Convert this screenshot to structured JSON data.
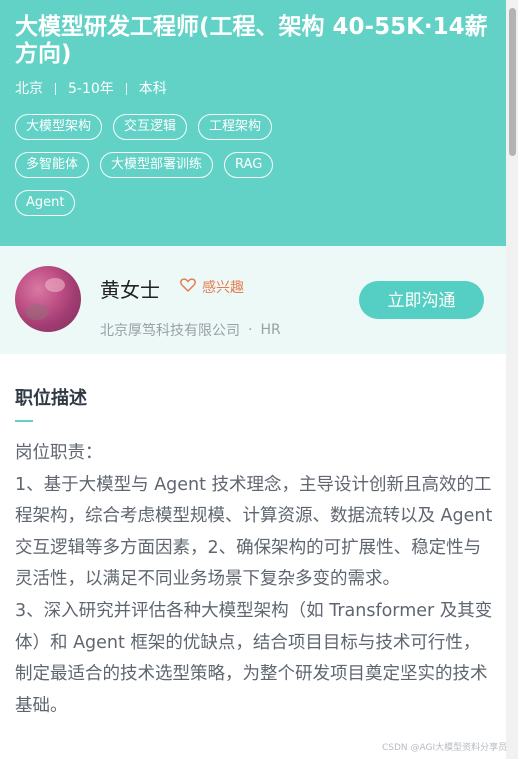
{
  "job": {
    "title": "大模型研发工程师(工程、架构 40-55K·14薪方向)",
    "city": "北京",
    "experience": "5-10年",
    "education": "本科",
    "tags_row1": [
      "大模型架构",
      "交互逻辑",
      "工程架构"
    ],
    "tags_row2": [
      "多智能体",
      "大模型部署训练",
      "RAG"
    ],
    "tags_row3": [
      "Agent"
    ]
  },
  "recruiter": {
    "name": "黄女士",
    "interest_label": "感兴趣",
    "company": "北京厚笃科技有限公司",
    "role": "HR",
    "contact_label": "立即沟通"
  },
  "description": {
    "heading": "职位描述",
    "paragraphs": [
      "岗位职责：",
      "1、基于大模型与 Agent 技术理念，主导设计创新且高效的工程架构，综合考虑模型规模、计算资源、数据流转以及 Agent 交互逻辑等多方面因素，2、确保架构的可扩展性、稳定性与灵活性，以满足不同业务场景下复杂多变的需求。",
      "3、深入研究并评估各种大模型架构（如 Transformer 及其变体）和 Agent 框架的优缺点，结合项目目标与技术可行性，制定最适合的技术选型策略，为整个研发项目奠定坚实的技术基础。"
    ]
  },
  "watermark": "CSDN @AGI大模型资料分享员",
  "colors": {
    "header_bg": "#62d2c7",
    "accent": "#55cfc3",
    "interest": "#e67e51"
  }
}
